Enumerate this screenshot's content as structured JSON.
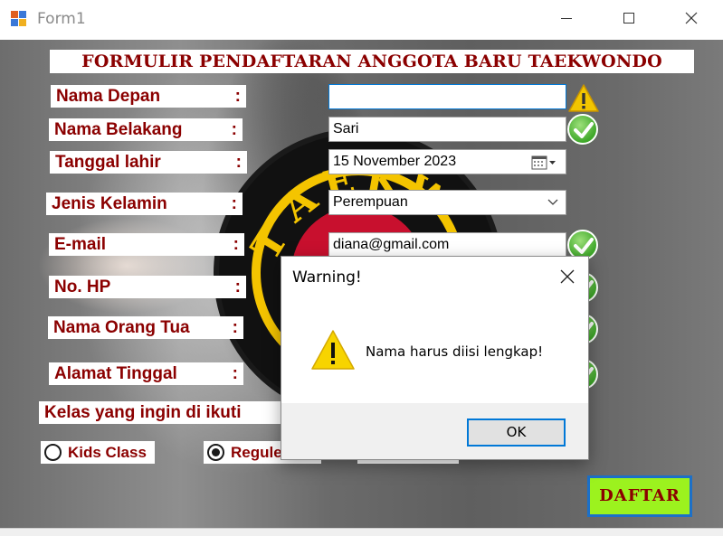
{
  "window": {
    "title": "Form1",
    "icon": "winforms-app-icon",
    "controls": [
      "minimize-icon",
      "maximize-icon",
      "close-icon"
    ]
  },
  "form": {
    "title": "FORMULIR PENDAFTARAN ANGGOTA BARU TAEKWONDO",
    "labels": {
      "nama_depan": "Nama Depan",
      "nama_belakang": "Nama Belakang",
      "tanggal_lahir": "Tanggal lahir",
      "jenis_kelamin": "Jenis Kelamin",
      "email": "E-mail",
      "no_hp": "No. HP",
      "nama_orang_tua": "Nama Orang Tua",
      "alamat_tinggal": "Alamat Tinggal",
      "kelas": "Kelas yang ingin di ikuti",
      "colon": ":"
    },
    "fields": {
      "nama_depan": "",
      "nama_belakang": "Sari",
      "tanggal_lahir": "15 November 2023",
      "jenis_kelamin": "Perempuan",
      "email": "diana@gmail.com"
    },
    "radios": {
      "kids_class": "Kids Class",
      "reguler": "Reguler",
      "selected": "reguler"
    },
    "submit_label": "DAFTAR",
    "colors": {
      "label_text": "#8b0000",
      "submit_bg": "#9cf21e",
      "submit_border": "#1c70c8",
      "valid_icon": "#3fa82a",
      "warning_icon": "#f2c500"
    }
  },
  "dialog": {
    "title": "Warning!",
    "message": "Nama harus diisi lengkap!",
    "icon": "warning-icon",
    "ok_label": "OK"
  }
}
